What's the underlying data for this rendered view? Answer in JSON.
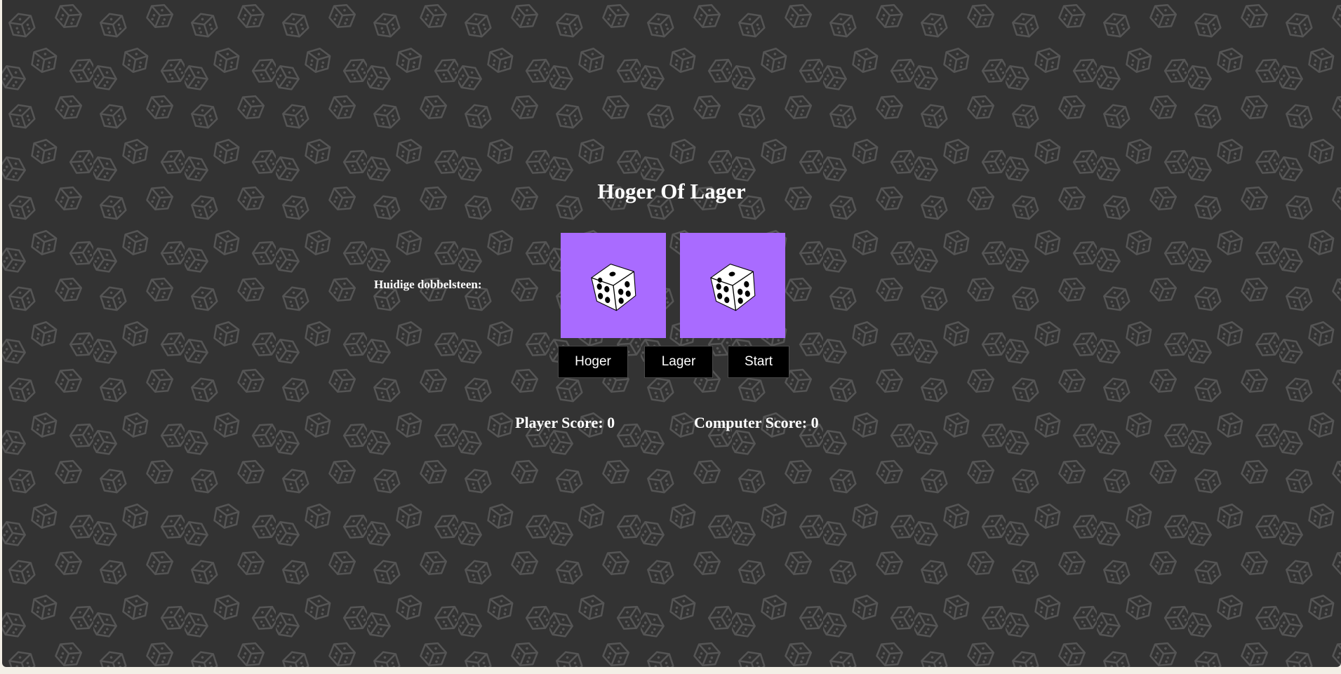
{
  "game": {
    "title": "Hoger Of Lager",
    "current_die_label": "Huidige dobbelsteen:",
    "dice": [
      {
        "face": 5,
        "icon": "die-five-icon",
        "card_color": "#a96bff"
      },
      {
        "face": 5,
        "icon": "die-five-icon",
        "card_color": "#a96bff"
      }
    ]
  },
  "controls": {
    "higher_label": "Hoger",
    "lower_label": "Lager",
    "start_label": "Start"
  },
  "scores": {
    "player_label": "Player Score:",
    "player_value": 0,
    "computer_label": "Computer Score:",
    "computer_value": 0
  },
  "theme": {
    "background": "#333333",
    "pattern_stroke": "#555555",
    "accent": "#a96bff",
    "button_bg": "#000000",
    "text": "#ffffff"
  }
}
